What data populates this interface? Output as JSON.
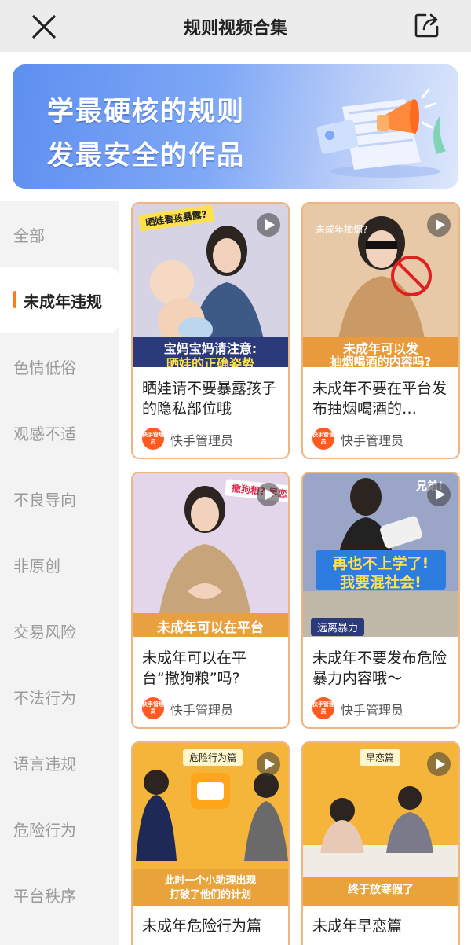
{
  "header": {
    "title": "规则视频合集"
  },
  "banner": {
    "line1": "学最硬核的规则",
    "line2": "发最安全的作品"
  },
  "sidebar": {
    "items": [
      {
        "label": "全部"
      },
      {
        "label": "未成年违规"
      },
      {
        "label": "色情低俗"
      },
      {
        "label": "观感不适"
      },
      {
        "label": "不良导向"
      },
      {
        "label": "非原创"
      },
      {
        "label": "交易风险"
      },
      {
        "label": "不法行为"
      },
      {
        "label": "语言违规"
      },
      {
        "label": "危险行为"
      },
      {
        "label": "平台秩序"
      }
    ],
    "active_index": 1
  },
  "videos": [
    {
      "title": "晒娃请不要暴露孩子的隐私部位哦",
      "author": "快手管理员",
      "thumb_caption_1": "宝妈宝妈请注意:",
      "thumb_caption_2": "晒娃的正确姿势",
      "thumb_sticker": "晒娃看孩暴露?"
    },
    {
      "title": "未成年不要在平台发布抽烟喝酒的…",
      "author": "快手管理员",
      "thumb_caption_1": "未成年可以发",
      "thumb_caption_2": "抽烟喝酒的内容吗?",
      "thumb_sticker": "未成年抽烟?"
    },
    {
      "title": "未成年可以在平台“撒狗粮”吗?",
      "author": "快手管理员",
      "thumb_caption_1": "未成年可以在平台",
      "thumb_sticker": "撒狗粮? 早恋?"
    },
    {
      "title": "未成年不要发布危险暴力内容哦～",
      "author": "快手管理员",
      "thumb_caption_1": "再也不上学了!",
      "thumb_caption_2": "我要混社会!",
      "thumb_tag": "远离暴力",
      "thumb_sticker": "兄弟!"
    },
    {
      "title": "未成年危险行为篇",
      "author": "",
      "thumb_tag": "危险行为篇",
      "thumb_caption_1": "此时一个小助理出现",
      "thumb_caption_2": "打破了他们的计划"
    },
    {
      "title": "未成年早恋篇",
      "author": "",
      "thumb_tag": "早恋篇",
      "thumb_caption_1": "终于放寒假了"
    }
  ],
  "avatar_text": "快手管理员",
  "colors": {
    "accent": "#ff7a1a",
    "card_border": "#f0b483",
    "banner": "#6f9cf3"
  }
}
